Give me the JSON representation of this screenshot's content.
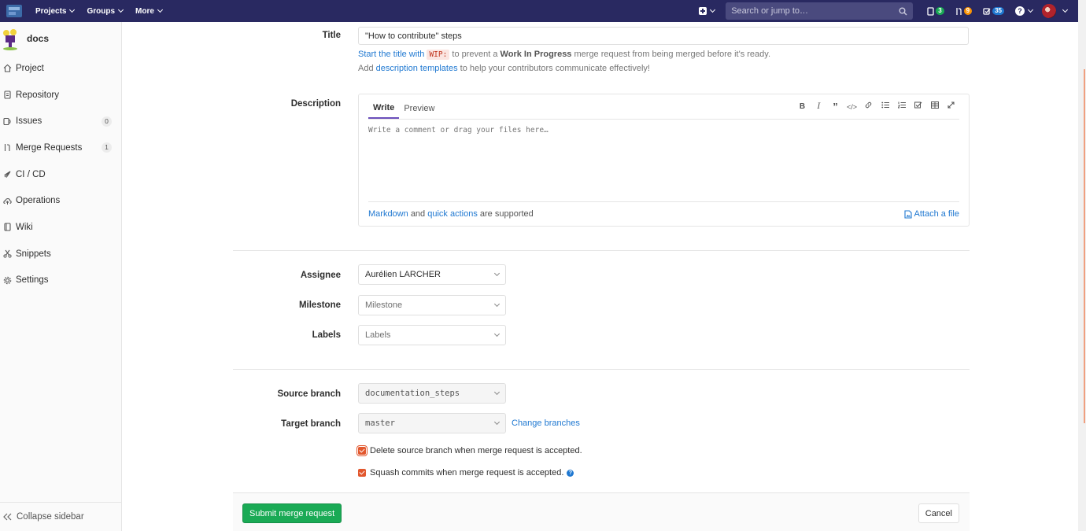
{
  "navbar": {
    "menu": [
      {
        "label": "Projects"
      },
      {
        "label": "Groups"
      },
      {
        "label": "More"
      }
    ],
    "search_placeholder": "Search or jump to…",
    "counters": [
      {
        "icon": "issues-icon",
        "value": "3",
        "color": "#1aaa55"
      },
      {
        "icon": "merge-request-icon",
        "value": "9",
        "color": "#fc9403"
      },
      {
        "icon": "todo-icon",
        "value": "35",
        "color": "#1f78d1"
      }
    ]
  },
  "sidebar": {
    "project_name": "docs",
    "items": [
      {
        "label": "Project",
        "icon": "home-icon"
      },
      {
        "label": "Repository",
        "icon": "doc-icon"
      },
      {
        "label": "Issues",
        "icon": "issues-icon",
        "count": "0"
      },
      {
        "label": "Merge Requests",
        "icon": "merge-request-icon",
        "count": "1"
      },
      {
        "label": "CI / CD",
        "icon": "rocket-icon"
      },
      {
        "label": "Operations",
        "icon": "cloud-icon"
      },
      {
        "label": "Wiki",
        "icon": "book-icon"
      },
      {
        "label": "Snippets",
        "icon": "scissors-icon"
      },
      {
        "label": "Settings",
        "icon": "gear-icon"
      }
    ],
    "collapse_label": "Collapse sidebar"
  },
  "form": {
    "title_label": "Title",
    "title_value": "\"How to contribute\" steps",
    "wip_hint": {
      "link": "Start the title with",
      "code": "WIP:",
      "pre_bold": "to prevent a",
      "bold": "Work In Progress",
      "post_bold": "merge request from being merged before it's ready."
    },
    "template_hint": {
      "pre": "Add",
      "link": "description templates",
      "post": "to help your contributors communicate effectively!"
    },
    "description_label": "Description",
    "tabs": [
      "Write",
      "Preview"
    ],
    "toolbar": [
      "bold-icon",
      "italic-icon",
      "quote-icon",
      "code-icon",
      "link-icon",
      "bullet-list-icon",
      "numbered-list-icon",
      "task-list-icon",
      "table-icon",
      "fullscreen-icon"
    ],
    "textarea_placeholder": "Write a comment or drag your files here…",
    "footer": {
      "markdown_link": "Markdown",
      "and": "and",
      "quick_link": "quick actions",
      "supported": "are supported",
      "attach": "Attach a file"
    },
    "assignee_label": "Assignee",
    "assignee_value": "Aurélien LARCHER",
    "milestone_label": "Milestone",
    "milestone_value": "Milestone",
    "labels_label": "Labels",
    "labels_value": "Labels",
    "source_label": "Source branch",
    "source_value": "documentation_steps",
    "target_label": "Target branch",
    "target_value": "master",
    "change_branches": "Change branches",
    "delete_branch": "Delete source branch when merge request is accepted.",
    "squash": "Squash commits when merge request is accepted.",
    "submit": "Submit merge request",
    "cancel": "Cancel"
  },
  "colors": {
    "navbar": "#292961",
    "link": "#1f78d1",
    "submit": "#1aaa55",
    "checkbox": "#e2572d"
  }
}
